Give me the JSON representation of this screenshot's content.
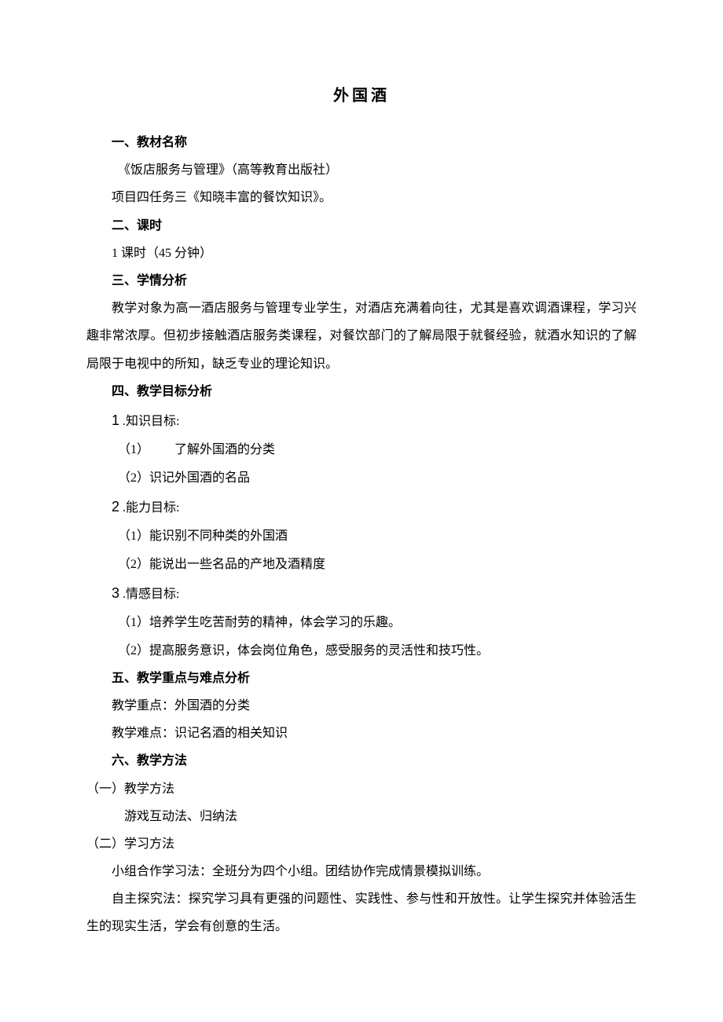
{
  "title": "外国酒",
  "s1": {
    "heading": "一、教材名称",
    "line1": "《饭店服务与管理》（高等教育出版社）",
    "line2": "项目四任务三《知晓丰富的餐饮知识》。"
  },
  "s2": {
    "heading": "二、课时",
    "line1": "1 课时（45 分钟）"
  },
  "s3": {
    "heading": "三、学情分析",
    "para": "教学对象为高一酒店服务与管理专业学生，对酒店充满着向往，尤其是喜欢调酒课程，学习兴趣非常浓厚。但初步接触酒店服务类课程，对餐饮部门的了解局限于就餐经验，就酒水知识的了解局限于电视中的所知，缺乏专业的理论知识。"
  },
  "s4": {
    "heading": "四、教学目标分析",
    "g1": {
      "label_num": "1",
      "label_text": " .知识目标:",
      "i1": "（1）  了解外国酒的分类",
      "i2": "（2）识记外国酒的名品"
    },
    "g2": {
      "label_num": "2",
      "label_text": " .能力目标:",
      "i1": "（1）能识别不同种类的外国酒",
      "i2": "（2）能说出一些名品的产地及酒精度"
    },
    "g3": {
      "label_num": "3",
      "label_text": " .情感目标:",
      "i1": "（1）培养学生吃苦耐劳的精神，体会学习的乐趣。",
      "i2": "（2）提高服务意识，体会岗位角色，感受服务的灵活性和技巧性。"
    }
  },
  "s5": {
    "heading": "五、教学重点与难点分析",
    "line1": "教学重点：外国酒的分类",
    "line2": "教学难点：识记名酒的相关知识"
  },
  "s6": {
    "heading": "六、教学方法",
    "m1": {
      "label": "（一）教学方法",
      "text": "游戏互动法、归纳法"
    },
    "m2": {
      "label": "（二）学习方法",
      "text1": "小组合作学习法：全班分为四个小组。团结协作完成情景模拟训练。",
      "text2": "自主探究法：探究学习具有更强的问题性、实践性、参与性和开放性。让学生探究并体验活生生的现实生活，学会有创意的生活。"
    }
  }
}
